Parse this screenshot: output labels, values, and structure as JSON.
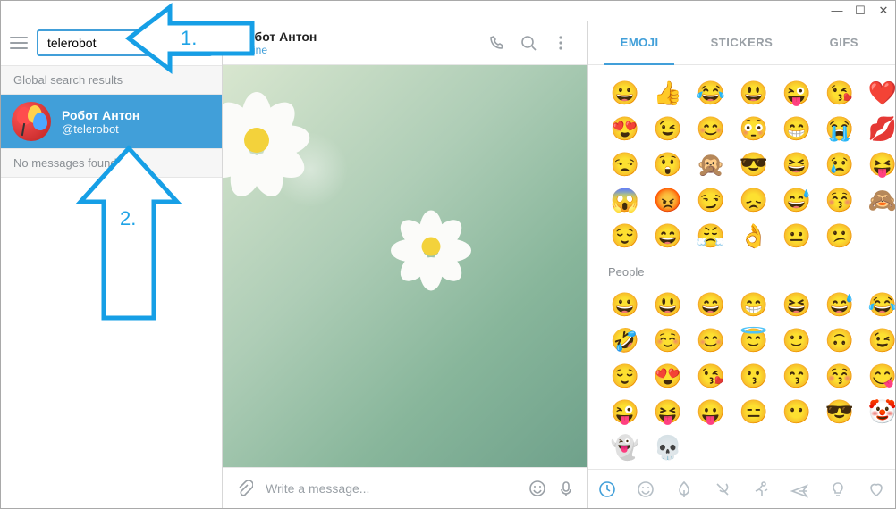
{
  "window": {
    "min": "—",
    "max": "☐",
    "close": "✕"
  },
  "sidebar": {
    "search_value": "telerobot",
    "section_global": "Global search results",
    "section_nomsg": "No messages found",
    "result": {
      "name": "Робот Антон",
      "handle": "@telerobot"
    }
  },
  "chat": {
    "title": "Робот Антон",
    "status": "online",
    "input_placeholder": "Write a message..."
  },
  "emoji": {
    "tabs": [
      "EMOJI",
      "STICKERS",
      "GIFS"
    ],
    "active_tab": 0,
    "recent": [
      "😀",
      "👍",
      "😂",
      "😃",
      "😜",
      "😘",
      "❤️",
      "😍",
      "😉",
      "😊",
      "😳",
      "😁",
      "😭",
      "💋",
      "😒",
      "😲",
      "🙊",
      "😎",
      "😆",
      "😢",
      "😝",
      "😱",
      "😡",
      "😏",
      "😞",
      "😅",
      "😚",
      "🙈",
      "😌",
      "😄",
      "😤",
      "👌",
      "😐",
      "😕"
    ],
    "people_title": "People",
    "people": [
      "😀",
      "😃",
      "😄",
      "😁",
      "😆",
      "😅",
      "😂",
      "🤣",
      "☺️",
      "😊",
      "😇",
      "🙂",
      "🙃",
      "😉",
      "😌",
      "😍",
      "😘",
      "😗",
      "😙",
      "😚",
      "😋",
      "😜",
      "😝",
      "😛",
      "😑",
      "😶",
      "😎",
      "🤡",
      "👻",
      "💀"
    ]
  },
  "annotations": {
    "step1": "1.",
    "step2": "2."
  }
}
